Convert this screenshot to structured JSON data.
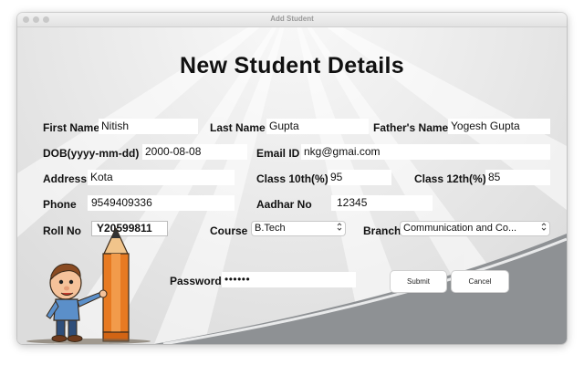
{
  "window": {
    "title": "Add Student"
  },
  "heading": "New Student Details",
  "fields": {
    "first_name": {
      "label": "First Name",
      "value": "Nitish"
    },
    "last_name": {
      "label": "Last Name",
      "value": "Gupta"
    },
    "father_name": {
      "label": "Father's Name",
      "value": "Yogesh Gupta"
    },
    "dob": {
      "label": "DOB(yyyy-mm-dd)",
      "value": "2000-08-08"
    },
    "email": {
      "label": "Email ID",
      "value": "nkg@gmai.com"
    },
    "address": {
      "label": "Address",
      "value": "Kota"
    },
    "class10": {
      "label": "Class 10th(%)",
      "value": "95"
    },
    "class12": {
      "label": "Class 12th(%)",
      "value": "85"
    },
    "phone": {
      "label": "Phone",
      "value": "9549409336"
    },
    "aadhar": {
      "label": "Aadhar No",
      "value": "12345"
    },
    "roll_no": {
      "label": "Roll No",
      "value": "Y20599811"
    },
    "course": {
      "label": "Course",
      "value": "B.Tech"
    },
    "branch": {
      "label": "Branch",
      "value": "Communication and Co..."
    },
    "password": {
      "label": "Password",
      "value": "••••••"
    }
  },
  "buttons": {
    "submit": "Submit",
    "cancel": "Cancel"
  },
  "icons": {
    "select_arrow": "⌃⌄"
  }
}
